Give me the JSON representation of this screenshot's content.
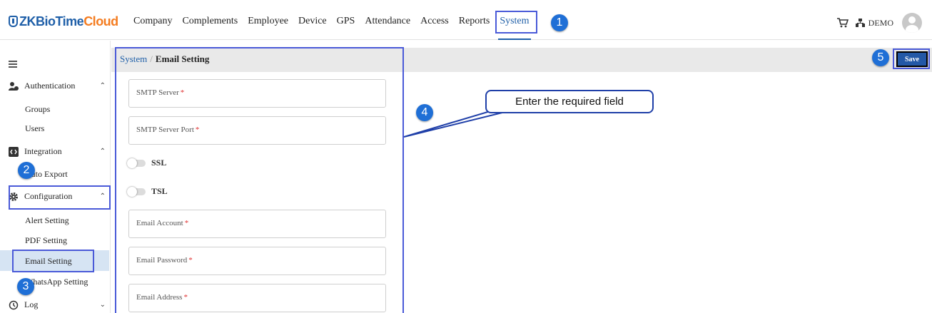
{
  "logo": {
    "part1": "ZKBioTime",
    "part2": "Cloud"
  },
  "nav": [
    "Company",
    "Complements",
    "Employee",
    "Device",
    "GPS",
    "Attendance",
    "Access",
    "Reports",
    "System"
  ],
  "user": {
    "name": "DEMO"
  },
  "sidebar": {
    "authentication": "Authentication",
    "groups": "Groups",
    "users": "Users",
    "integration": "Integration",
    "auto_export": "Auto Export",
    "configuration": "Configuration",
    "alert_setting": "Alert Setting",
    "pdf_setting": "PDF Setting",
    "email_setting": "Email Setting",
    "whatsapp_setting": "WhatsApp Setting",
    "log": "Log"
  },
  "breadcrumb": {
    "root": "System",
    "sep": "/",
    "current": "Email Setting"
  },
  "save_label": "Save",
  "form": {
    "smtp_server": "SMTP Server",
    "smtp_port": "SMTP Server Port",
    "ssl": "SSL",
    "tsl": "TSL",
    "email_account": "Email Account",
    "email_password": "Email Password",
    "email_address": "Email Address",
    "required_mark": "*"
  },
  "callout_text": "Enter the required field",
  "steps": [
    "1",
    "2",
    "3",
    "4",
    "5"
  ]
}
